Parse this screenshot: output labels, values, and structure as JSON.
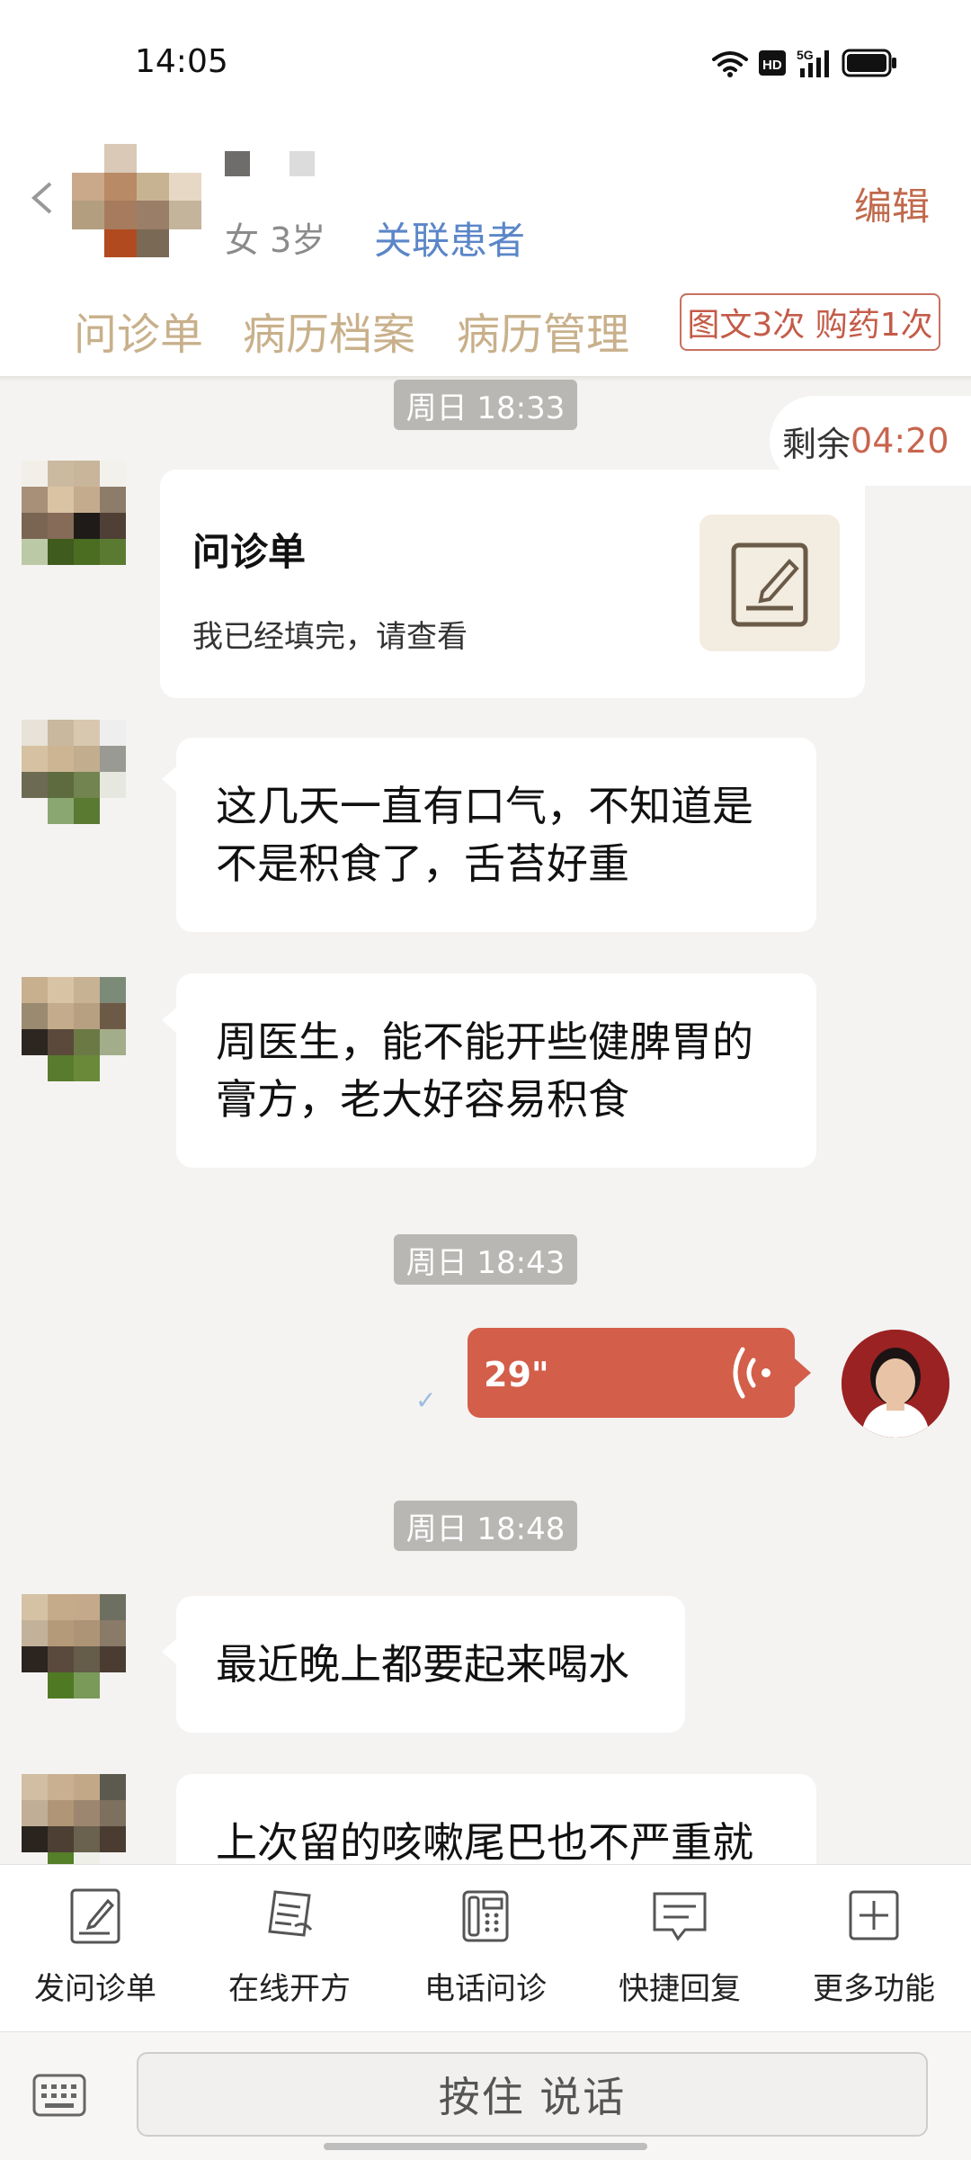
{
  "status_bar": {
    "time": "14:05",
    "network": "5G",
    "hd": "HD"
  },
  "header": {
    "gender_age": "女 3岁",
    "link_patient": "关联患者",
    "edit": "编辑",
    "tabs": [
      "问诊单",
      "病历档案",
      "病历管理"
    ],
    "service_badge": "图文3次 购药1次"
  },
  "remaining": {
    "label": "剩余",
    "value": "04:20"
  },
  "timestamps": [
    "周日 18:33",
    "周日 18:43",
    "周日 18:48"
  ],
  "messages": {
    "form_card": {
      "title": "问诊单",
      "subtitle": "我已经填完，请查看"
    },
    "msg1": "这几天一直有口气，不知道是不是积食了，舌苔好重",
    "msg2": "周医生，能不能开些健脾胃的膏方，老大好容易积食",
    "voice_duration": "29\"",
    "msg3": "最近晚上都要起来喝水",
    "msg4": "上次留的咳嗽尾巴也不严重就"
  },
  "toolbar": [
    {
      "label": "发问诊单",
      "icon": "form-edit-icon"
    },
    {
      "label": "在线开方",
      "icon": "prescription-icon"
    },
    {
      "label": "电话问诊",
      "icon": "phone-icon"
    },
    {
      "label": "快捷回复",
      "icon": "quick-reply-icon"
    },
    {
      "label": "更多功能",
      "icon": "plus-icon"
    }
  ],
  "input": {
    "push_to_talk": "按住 说话"
  },
  "colors": {
    "accent": "#c8654e",
    "tab": "#c8b08b",
    "link": "#5b86c8",
    "voice": "#d35e4a"
  }
}
